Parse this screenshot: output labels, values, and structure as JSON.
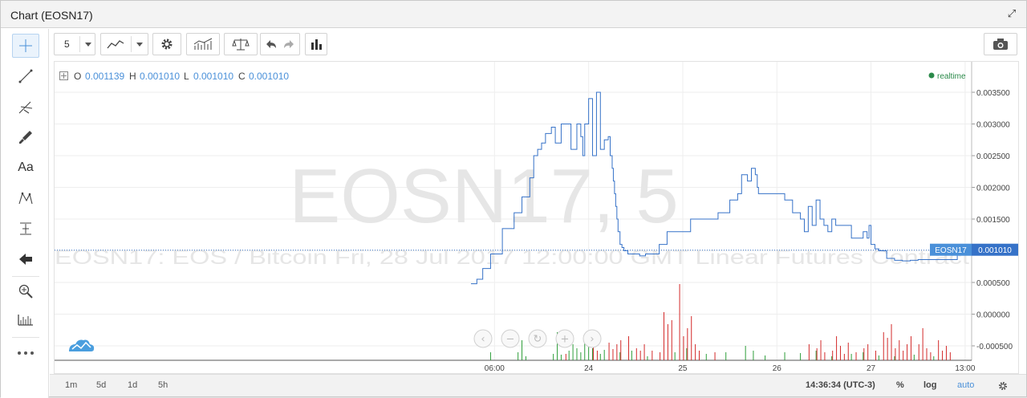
{
  "window": {
    "title": "Chart (EOSN17)"
  },
  "toolbar": {
    "interval": "5"
  },
  "legend": {
    "o_label": "O",
    "o": "0.001139",
    "h_label": "H",
    "h": "0.001010",
    "l_label": "L",
    "l": "0.001010",
    "c_label": "C",
    "c": "0.001010"
  },
  "realtime": "realtime",
  "watermark": {
    "big": "EOSN17, 5",
    "small": "EOSN17: EOS / Bitcoin Fri, 28 Jul 2017 12:00:00 GMT Linear Futures Contract"
  },
  "price_tag": {
    "symbol": "EOSN17",
    "value": "0.001010"
  },
  "bottom": {
    "ranges": [
      "1m",
      "5d",
      "1d",
      "5h"
    ],
    "time": "14:36:34 (UTC-3)",
    "percent": "%",
    "log": "log",
    "auto": "auto"
  },
  "colors": {
    "line": "#3672c8",
    "up": "#2e9e3a",
    "down": "#d32a2a",
    "accent": "#4a90d9",
    "realtime": "#2b8a4a"
  },
  "chart_data": {
    "type": "line",
    "title": "EOSN17, 5",
    "subtitle": "EOSN17: EOS / Bitcoin Fri, 28 Jul 2017 12:00:00 GMT Linear Futures Contract",
    "x_ticks": [
      "06:00",
      "24",
      "25",
      "26",
      "27",
      "13:00"
    ],
    "y_ticks": [
      "0.003500",
      "0.003000",
      "0.002500",
      "0.002000",
      "0.001500",
      "0.001000",
      "0.000500",
      "0.000000",
      "-0.000500"
    ],
    "ylim": [
      -0.0007,
      0.0036
    ],
    "xlim": [
      0,
      125
    ],
    "x_tick_positions": [
      6,
      30,
      54,
      78,
      102,
      126
    ],
    "series": [
      {
        "x": [
          0,
          1.5,
          3,
          5,
          8,
          11,
          13,
          15,
          16,
          17,
          18,
          19,
          20.5,
          21.5,
          23,
          24.5,
          25.5,
          27,
          28,
          28.5,
          29,
          30,
          31,
          32,
          33,
          34,
          35,
          35.5,
          36,
          36.3,
          36.6,
          36.9,
          37.2,
          37.5,
          38,
          38.5,
          39,
          40,
          41.5,
          43,
          44.5,
          46,
          48,
          50,
          53,
          56,
          60,
          63,
          66,
          68,
          69,
          70.5,
          71.5,
          72.5,
          73,
          73.3,
          73.6,
          74,
          75,
          76,
          78,
          80,
          82,
          84,
          85,
          86,
          87,
          88,
          89,
          90,
          91,
          92,
          93,
          95,
          97,
          99,
          100,
          101,
          101.5,
          102,
          103,
          104,
          106,
          108,
          110,
          112,
          114,
          116,
          118,
          119,
          120,
          121,
          122,
          123,
          124,
          125
        ],
        "y": [
          0.00048,
          0.00055,
          0.00072,
          0.00095,
          0.00135,
          0.0016,
          0.00185,
          0.00215,
          0.0025,
          0.0026,
          0.0027,
          0.00285,
          0.00295,
          0.0027,
          0.003,
          0.003,
          0.0026,
          0.003,
          0.0028,
          0.0025,
          0.003,
          0.0034,
          0.0025,
          0.0035,
          0.0026,
          0.00275,
          0.0028,
          0.0025,
          0.0023,
          0.0021,
          0.0019,
          0.0017,
          0.0015,
          0.0013,
          0.0011,
          0.00105,
          0.001,
          0.00095,
          0.00095,
          0.00092,
          0.00095,
          0.00095,
          0.0011,
          0.0013,
          0.0013,
          0.0015,
          0.0015,
          0.0016,
          0.0018,
          0.0019,
          0.0022,
          0.0021,
          0.0023,
          0.0022,
          0.002,
          0.0019,
          0.0019,
          0.0019,
          0.0019,
          0.0019,
          0.0019,
          0.0018,
          0.0016,
          0.0015,
          0.0013,
          0.0017,
          0.0014,
          0.0018,
          0.0015,
          0.0014,
          0.0013,
          0.0015,
          0.0014,
          0.0014,
          0.0012,
          0.0012,
          0.0013,
          0.0012,
          0.0014,
          0.0011,
          0.00103,
          0.001,
          0.00088,
          0.00085,
          0.00084,
          0.00085,
          0.00086,
          0.00086,
          0.00086,
          0.00086,
          0.00086,
          0.00086,
          0.00086,
          0.00086,
          0.0011,
          0.00101
        ]
      }
    ],
    "volume_up": [
      [
        5,
        0.1
      ],
      [
        12,
        0.1
      ],
      [
        13,
        0.25
      ],
      [
        14,
        0.05
      ],
      [
        21,
        0.08
      ],
      [
        22,
        0.35
      ],
      [
        23,
        0.07
      ],
      [
        25,
        0.12
      ],
      [
        26,
        0.2
      ],
      [
        27,
        0.15
      ],
      [
        28,
        0.1
      ],
      [
        29,
        0.22
      ],
      [
        30,
        0.3
      ],
      [
        31,
        0.15
      ],
      [
        33,
        0.08
      ],
      [
        34,
        0.13
      ],
      [
        38,
        0.1
      ],
      [
        41,
        0.12
      ],
      [
        45,
        0.05
      ],
      [
        52,
        0.1
      ],
      [
        55,
        0.15
      ],
      [
        60,
        0.08
      ],
      [
        65,
        0.1
      ],
      [
        70,
        0.18
      ],
      [
        72,
        0.12
      ],
      [
        75,
        0.06
      ],
      [
        80,
        0.1
      ],
      [
        84,
        0.09
      ],
      [
        88,
        0.12
      ],
      [
        92,
        0.05
      ],
      [
        97,
        0.08
      ],
      [
        100,
        0.1
      ],
      [
        104,
        0.06
      ],
      [
        108,
        0.05
      ],
      [
        113,
        0.07
      ],
      [
        118,
        0.05
      ]
    ],
    "volume_down": [
      [
        24,
        0.08
      ],
      [
        31,
        0.18
      ],
      [
        32,
        0.12
      ],
      [
        35,
        0.22
      ],
      [
        36,
        0.14
      ],
      [
        37,
        0.2
      ],
      [
        38,
        0.25
      ],
      [
        40,
        0.3
      ],
      [
        42,
        0.15
      ],
      [
        43,
        0.12
      ],
      [
        44,
        0.2
      ],
      [
        46,
        0.12
      ],
      [
        48,
        0.1
      ],
      [
        49,
        0.6
      ],
      [
        50,
        0.45
      ],
      [
        51,
        0.5
      ],
      [
        53,
        0.95
      ],
      [
        54,
        0.3
      ],
      [
        55,
        0.4
      ],
      [
        56,
        0.55
      ],
      [
        57,
        0.2
      ],
      [
        58,
        0.12
      ],
      [
        62,
        0.1
      ],
      [
        86,
        0.2
      ],
      [
        88,
        0.15
      ],
      [
        89,
        0.25
      ],
      [
        90,
        0.1
      ],
      [
        92,
        0.12
      ],
      [
        93,
        0.3
      ],
      [
        94,
        0.18
      ],
      [
        95,
        0.08
      ],
      [
        96,
        0.22
      ],
      [
        98,
        0.1
      ],
      [
        100,
        0.15
      ],
      [
        101,
        0.2
      ],
      [
        103,
        0.12
      ],
      [
        105,
        0.35
      ],
      [
        106,
        0.28
      ],
      [
        107,
        0.45
      ],
      [
        108,
        0.15
      ],
      [
        109,
        0.25
      ],
      [
        110,
        0.12
      ],
      [
        111,
        0.2
      ],
      [
        112,
        0.3
      ],
      [
        114,
        0.2
      ],
      [
        115,
        0.4
      ],
      [
        116,
        0.15
      ],
      [
        117,
        0.1
      ],
      [
        119,
        0.25
      ],
      [
        120,
        0.12
      ],
      [
        121,
        0.18
      ],
      [
        122,
        0.1
      ]
    ]
  }
}
